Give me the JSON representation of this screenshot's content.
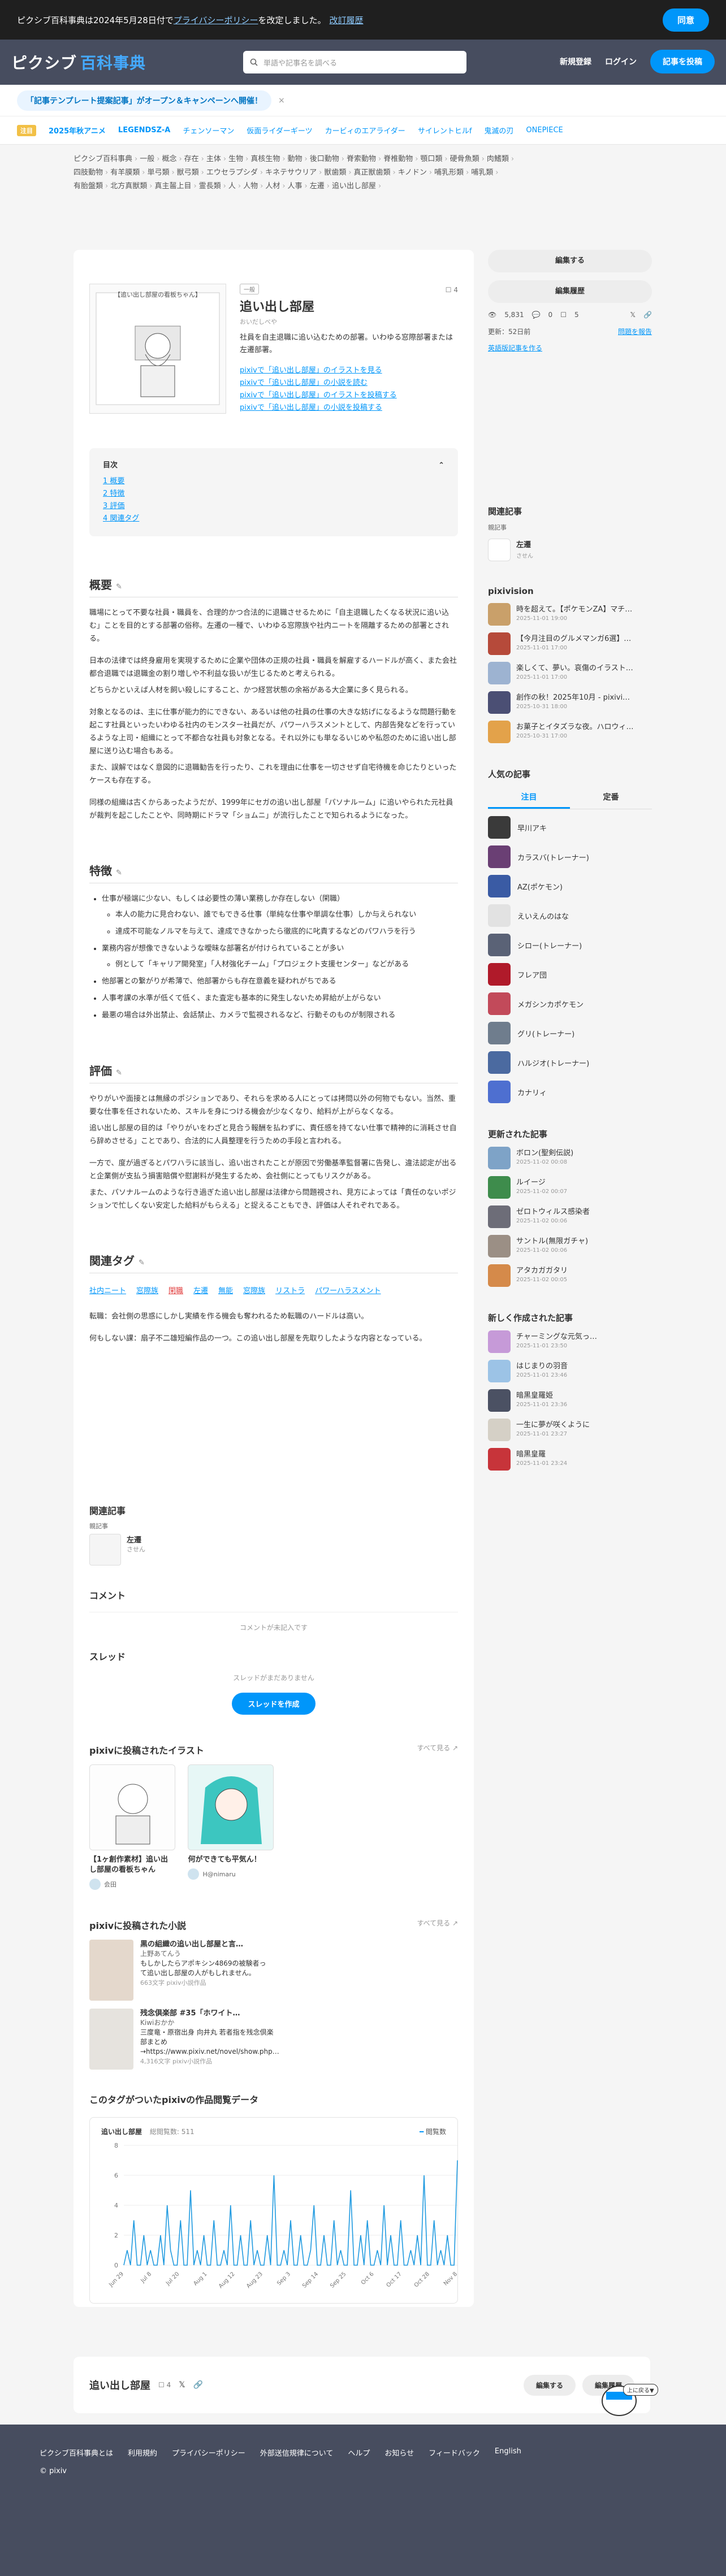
{
  "notice": {
    "text": "ピクシブ百科事典は2024年5月28日付で",
    "link": "プライバシーポリシー",
    "text2": "を改定しました。",
    "link2": "改訂履歴",
    "ok": "同意"
  },
  "header": {
    "logo_a": "ピクシブ",
    "logo_b": "百科事典",
    "search_placeholder": "単語や記事名を調べる",
    "new_article": "新規登録",
    "login": "ログイン",
    "edit": "記事を投稿"
  },
  "promo": {
    "text": "「記事テンプレート提案記事」がオープン＆キャンペーンへ開催！",
    "close": "×"
  },
  "trend": {
    "badge": "注目",
    "items": [
      "2025年秋アニメ",
      "LEGENDSZ-A",
      "チェンソーマン",
      "仮面ライダーギーツ",
      "カービィのエアライダー",
      "サイレントヒルf",
      "鬼滅の刃",
      "ONEPIECE"
    ]
  },
  "breadcrumb": {
    "line1": [
      "ピクシブ百科事典",
      "一般",
      "概念",
      "存在",
      "主体",
      "生物",
      "真核生物",
      "動物",
      "後口動物",
      "脊索動物",
      "脊椎動物",
      "顎口類",
      "硬骨魚類",
      "肉鰭類"
    ],
    "line2": [
      "四肢動物",
      "有羊膜類",
      "単弓類",
      "獣弓類",
      "エウセラプシダ",
      "キネテサウリア",
      "獣歯類",
      "真正獣歯類",
      "キノドン",
      "哺乳形類",
      "哺乳類"
    ],
    "line3": [
      "有胎盤類",
      "北方真獣類",
      "真主齧上目",
      "霊長類",
      "人",
      "人物",
      "人材",
      "人事",
      "左遷",
      "追い出し部屋"
    ]
  },
  "article": {
    "thumb_caption": "【追い出し部屋の看板ちゃん】",
    "small_tag": "一般",
    "title": "追い出し部屋",
    "reading": "おいだしべや",
    "bookmark_count": "4",
    "summary": "社員を自主退職に追い込むための部署。いわゆる窓際部署または左遷部署。",
    "pix_links": [
      "pixivで「追い出し部屋」のイラストを見る",
      "pixivで「追い出し部屋」の小説を読む",
      "pixivで「追い出し部屋」のイラストを投稿する",
      "pixivで「追い出し部屋」の小説を投稿する"
    ]
  },
  "toc": {
    "title": "目次",
    "items": [
      "1 概要",
      "2 特徴",
      "3 評価",
      "4 関連タグ"
    ]
  },
  "sections": {
    "overview_title": "概要",
    "overview_p1": "職場にとって不要な社員・職員を、合理的かつ合法的に退職させるために「自主退職したくなる状況に追い込む」ことを目的とする部署の俗称。左遷の一種で、いわゆる窓際族や社内ニートを隔離するための部署とされる。",
    "overview_p2": "日本の法律では終身雇用を実現するために企業や団体の正規の社員・職員を解雇するハードルが高く、また会社都合退職では退職金の割り増しや不利益な扱いが生じるためと考えられる。",
    "overview_p3": "どちらかといえば人材を飼い殺しにすること、かつ経営状態の余裕がある大企業に多く見られる。",
    "overview_p4": "対象となるのは、主に仕事が能力的にできない、あるいは他の社員の仕事の大きな妨げになるような問題行動を起こす社員といったいわゆる社内のモンスター社員だが、パワーハラスメントとして、内部告発などを行っているような上司・組織にとって不都合な社員も対象となる。それ以外にも単なるいじめや私怨のために追い出し部屋に送り込む場合もある。",
    "overview_p5": "また、誤解ではなく意図的に退職勧告を行ったり、これを理由に仕事を一切させず自宅待機を命じたりといったケースも存在する。",
    "overview_p6": "同様の組織は古くからあったようだが、1999年にセガの追い出し部屋「パソナルーム」に追いやられた元社員が裁判を起こしたことや、同時期にドラマ「ショムニ」が流行したことで知られるようになった。",
    "features_title": "特徴",
    "features": [
      "仕事が極端に少ない、もしくは必要性の薄い業務しか存在しない（閑職）",
      "本人の能力に見合わない、誰でもできる仕事（単純な仕事や単調な仕事）しか与えられない",
      "達成不可能なノルマを与えて、達成できなかったら徹底的に叱責するなどのパワハラを行う",
      "業務内容が想像できないような曖昧な部署名が付けられていることが多い",
      "例として「キャリア開発室」「人材強化チーム」「プロジェクト支援センター」などがある",
      "他部署との繋がりが希薄で、他部署からも存在意義を疑われがちである",
      "人事考課の水準が低くて低く、また査定も基本的に発生しないため昇給が上がらない",
      "最悪の場合は外出禁止、会話禁止、カメラで監視されるなど、行動そのものが制限される"
    ],
    "eval_title": "評価",
    "eval_p1": "やりがいや面接とは無縁のポジションであり、それらを求める人にとっては拷問以外の何物でもない。当然、重要な仕事を任されないため、スキルを身につける機会が少なくなり、給料が上がらなくなる。",
    "eval_p2": "追い出し部屋の目的は「やりがいをわざと見合う報酬を払わずに、責任感を持てない仕事で精神的に消耗させ自ら辞めさせる」ことであり、合法的に人員整理を行うための手段と言われる。",
    "eval_p3": "一方で、度が過ぎるとパワハラに該当し、追い出されたことが原因で労働基準監督署に告発し、違法認定が出ると企業側が支払う損害賠償や慰謝料が発生するため、会社側にとってもリスクがある。",
    "eval_p4": "また、パソナルームのような行き過ぎた追い出し部屋は法律から問題視され、見方によっては「責任のないポジションで忙しくない安定した給料がもらえる」と捉えることもでき、評価は人それぞれである。",
    "related_title": "関連タグ",
    "related_tags": [
      "社内ニート",
      "窓際族",
      "閑職",
      "左遷",
      "無能",
      "窓際族",
      "リストラ",
      "パワーハラスメント"
    ],
    "related_p1": "転職：会社側の思惑にしかし実績を作る機会も奪われるため転職のハードルは高い。",
    "related_p2": "何もしない課：扇子不二雄短編作品の一つ。この追い出し部屋を先取りしたような内容となっている。"
  },
  "related_articles": {
    "title": "関連記事",
    "sub": "親記事",
    "item": "左遷",
    "item_sub": "させん"
  },
  "comments": {
    "title": "コメント",
    "empty": "コメントが未記入です"
  },
  "thread": {
    "title": "スレッド",
    "empty": "スレッドがまだありません",
    "button": "スレッドを作成"
  },
  "illusts": {
    "title": "pixivに投稿されたイラスト",
    "more": "すべて見る",
    "items": [
      {
        "title": "【1ヶ創作素材】追い出し部屋の看板ちゃん",
        "author": "会田"
      },
      {
        "title": "何ができても平気ん！",
        "author": "H@nimaru"
      }
    ]
  },
  "novels": {
    "title": "pixivに投稿された小説",
    "more": "すべて見る",
    "items": [
      {
        "title": "黒の組織の追い出し部屋と言…",
        "author": "上野あてんう",
        "desc": "もしかしたらアポキシン4869の被験者って追い出し部屋の人がもしれません。",
        "meta": "663文字 pixiv小説作品"
      },
      {
        "title": "残念倶楽部 #35「ホワイト…",
        "author": "Kiwiおかか",
        "desc": "三度竜・原宿出身 向井丸 若者指を残念倶楽部まとめ→https://www.pixiv.net/novel/show.php…",
        "meta": "4,316文字 pixiv小説作品"
      }
    ]
  },
  "views": {
    "title": "このタグがついたpixivの作品閲覧データ",
    "chart_label": "追い出し部屋",
    "total_label": "総閲覧数: 511",
    "legend": "閲覧数"
  },
  "chart_data": {
    "type": "line",
    "title": "追い出し部屋",
    "ylim": [
      0,
      8
    ],
    "yticks": [
      0,
      2,
      4,
      6,
      8
    ],
    "x_labels": [
      "Jun 29",
      "Jul 8",
      "Jul 20",
      "Aug 1",
      "Aug 12",
      "Aug 23",
      "Sep 3",
      "Sep 14",
      "Sep 25",
      "Oct 6",
      "Oct 17",
      "Oct 28",
      "Nov 8"
    ],
    "values": [
      0,
      1,
      0,
      3,
      0,
      0,
      2,
      0,
      1,
      0,
      0,
      2,
      0,
      4,
      1,
      0,
      0,
      3,
      0,
      0,
      5,
      0,
      1,
      0,
      2,
      0,
      0,
      3,
      0,
      0,
      1,
      0,
      4,
      0,
      0,
      2,
      0,
      0,
      3,
      0,
      1,
      0,
      0,
      2,
      0,
      6,
      0,
      0,
      1,
      0,
      3,
      0,
      0,
      2,
      0,
      0,
      1,
      4,
      0,
      0,
      2,
      0,
      0,
      3,
      0,
      1,
      0,
      0,
      5,
      0,
      0,
      2,
      0,
      3,
      0,
      0,
      1,
      0,
      4,
      0,
      2,
      0,
      0,
      3,
      0,
      0,
      1,
      0,
      2,
      0,
      6,
      0,
      0,
      3,
      0,
      1,
      0,
      2,
      0,
      0,
      7
    ]
  },
  "footer_bar": {
    "title": "追い出し部屋",
    "bookmark": "4",
    "edit": "編集する",
    "history": "編集履歴"
  },
  "float": {
    "text": "上に戻る▼"
  },
  "footer": {
    "links": [
      "ピクシブ百科事典とは",
      "利用規約",
      "プライバシーポリシー",
      "外部送信規律について",
      "ヘルプ",
      "お知らせ",
      "フィードバック",
      "English"
    ],
    "copyright": "© pixiv"
  },
  "side": {
    "edit": "編集する",
    "history": "編集履歴",
    "views": "5,831",
    "comments": "0",
    "bookmarks": "5",
    "updated": "更新：52日前",
    "report": "問題を報告",
    "english": "英語版記事を作る",
    "related_title": "関連記事",
    "related_sub": "親記事",
    "related_item": "左遷",
    "related_item_sub": "させん",
    "pixivision_title": "pixivision",
    "pixivision": [
      {
        "title": "時を超えて。【ポケモンZA】マチ…",
        "date": "2025-11-01 19:00"
      },
      {
        "title": "【今月注目のグルメマンガ6選】…",
        "date": "2025-11-01 17:00"
      },
      {
        "title": "楽しくて、夢い。哀傷のイラスト…",
        "date": "2025-11-01 17:00"
      },
      {
        "title": "創作の秋！2025年10月 - pixivi…",
        "date": "2025-10-31 18:00"
      },
      {
        "title": "お菓子とイタズラな夜。ハロウィ…",
        "date": "2025-10-31 17:00"
      }
    ],
    "popular_title": "人気の記事",
    "tab_attention": "注目",
    "tab_regular": "定番",
    "popular": [
      "早川アキ",
      "カラスバ(トレーナー)",
      "AZ(ポケモン)",
      "えいえんのはな",
      "シロー(トレーナー)",
      "フレア団",
      "メガシンカポケモン",
      "グリ(トレーナー)",
      "ハルジオ(トレーナー)",
      "カナリィ"
    ],
    "updated_title": "更新された記事",
    "updated_items": [
      {
        "title": "ボロン(聖剣伝説)",
        "date": "2025-11-02 00:08"
      },
      {
        "title": "ルイージ",
        "date": "2025-11-02 00:07"
      },
      {
        "title": "ゼロトウィルス感染者",
        "date": "2025-11-02 00:06"
      },
      {
        "title": "サントル(無限ガチャ)",
        "date": "2025-11-02 00:06"
      },
      {
        "title": "アタカガガタリ",
        "date": "2025-11-02 00:05"
      }
    ],
    "new_title": "新しく作成された記事",
    "new_items": [
      {
        "title": "チャーミングな元気っ…",
        "date": "2025-11-01 23:50"
      },
      {
        "title": "はじまりの羽音",
        "date": "2025-11-01 23:46"
      },
      {
        "title": "暗黒皇羅姫",
        "date": "2025-11-01 23:36"
      },
      {
        "title": "一生に夢が咲くように",
        "date": "2025-11-01 23:27"
      },
      {
        "title": "暗黒皇羅",
        "date": "2025-11-01 23:24"
      }
    ]
  }
}
